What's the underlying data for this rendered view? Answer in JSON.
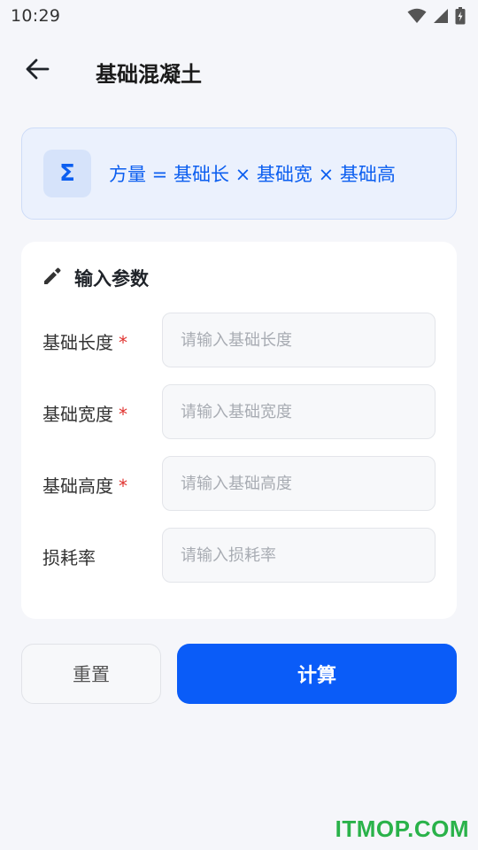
{
  "status_bar": {
    "time": "10:29"
  },
  "header": {
    "title": "基础混凝土"
  },
  "formula": {
    "icon": "Σ",
    "text": "方量 = 基础长 × 基础宽 × 基础高"
  },
  "input_section": {
    "title": "输入参数",
    "fields": [
      {
        "label": "基础长度",
        "required_mark": "*",
        "placeholder": "请输入基础长度",
        "value": ""
      },
      {
        "label": "基础宽度",
        "required_mark": "*",
        "placeholder": "请输入基础宽度",
        "value": ""
      },
      {
        "label": "基础高度",
        "required_mark": "*",
        "placeholder": "请输入基础高度",
        "value": ""
      },
      {
        "label": "损耗率",
        "required_mark": "",
        "placeholder": "请输入损耗率",
        "value": ""
      }
    ]
  },
  "actions": {
    "reset_label": "重置",
    "calculate_label": "计算"
  },
  "watermark": "ITMOP.COM",
  "colors": {
    "accent": "#0a5cf8",
    "required": "#e0322e",
    "watermark": "#2ab24a"
  }
}
